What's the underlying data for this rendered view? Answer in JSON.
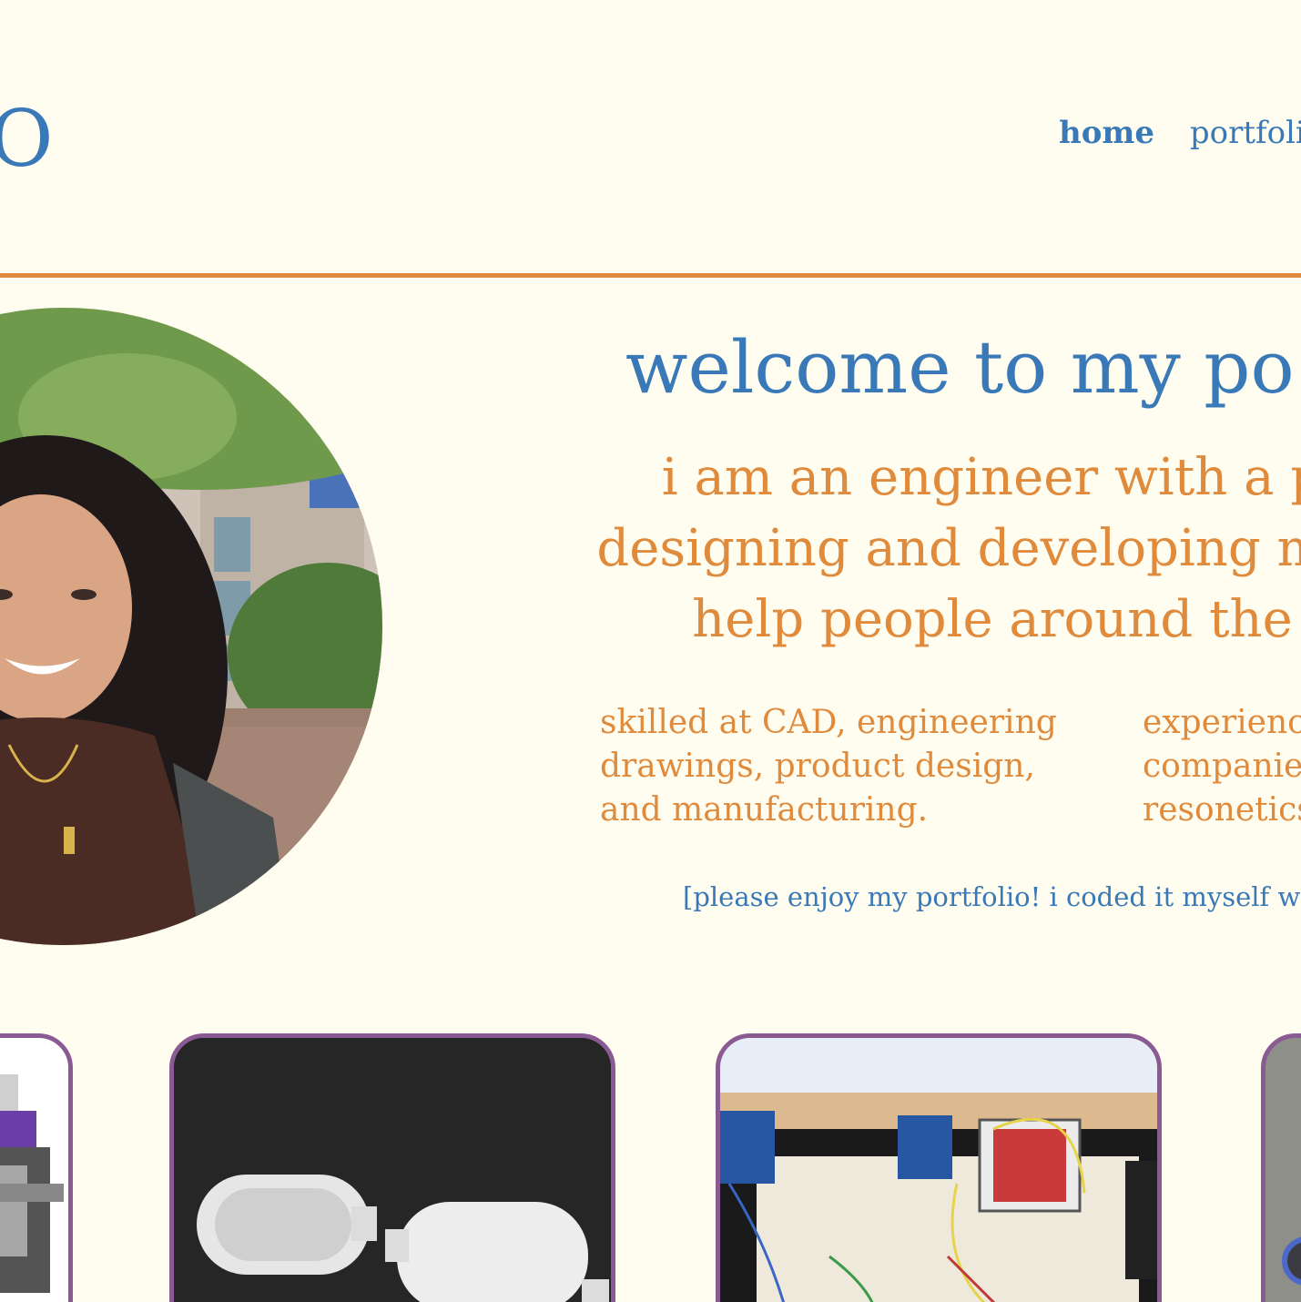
{
  "header": {
    "logo_text": "O",
    "nav": [
      {
        "label": "home",
        "active": true
      },
      {
        "label": "portfolio",
        "active": false
      }
    ]
  },
  "hero": {
    "headline": "welcome to my po",
    "tagline": [
      "i am an engineer with a p",
      "designing and developing med",
      "help people around the"
    ],
    "skills": "skilled at CAD, engineering drawings, product design, and manufacturing.",
    "experience": [
      "experienc",
      "companie",
      "resonetics"
    ],
    "note": "[please enjoy my portfolio! i coded it myself with"
  },
  "portfolio": {
    "cards": [
      {
        "image": "cad-assembly-model"
      },
      {
        "image": "white-enclosure-render"
      },
      {
        "image": "xbee-breadboard-led-matrix"
      },
      {
        "image": "metal-device-photo"
      }
    ]
  },
  "colors": {
    "background": "#fffdf0",
    "primary_blue": "#3a79b7",
    "accent_orange": "#e08a3c",
    "card_border_purple": "#8a5a93"
  }
}
